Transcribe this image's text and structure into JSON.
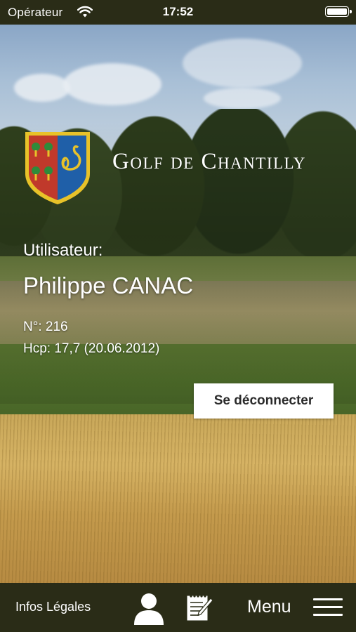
{
  "status_bar": {
    "carrier": "Opérateur",
    "time": "17:52",
    "wifi_icon": "wifi-icon",
    "battery_icon": "battery-icon"
  },
  "header": {
    "club_name": "Golf de Chantilly",
    "crest_icon": "coat-of-arms-icon"
  },
  "user": {
    "caption": "Utilisateur:",
    "name": "Philippe CANAC",
    "member_number": "N°: 216",
    "handicap": "Hcp: 17,7 (20.06.2012)"
  },
  "actions": {
    "logout_label": "Se déconnecter"
  },
  "bottom_bar": {
    "legal_label": "Infos Légales",
    "profile_icon": "person-icon",
    "notes_icon": "notepad-icon",
    "menu_label": "Menu",
    "menu_icon": "hamburger-icon"
  },
  "colors": {
    "bar_background": "#2a2c17",
    "button_background": "#ffffff",
    "crest_red": "#c0392b",
    "crest_blue": "#1f5fa8",
    "crest_gold": "#e8c229"
  }
}
